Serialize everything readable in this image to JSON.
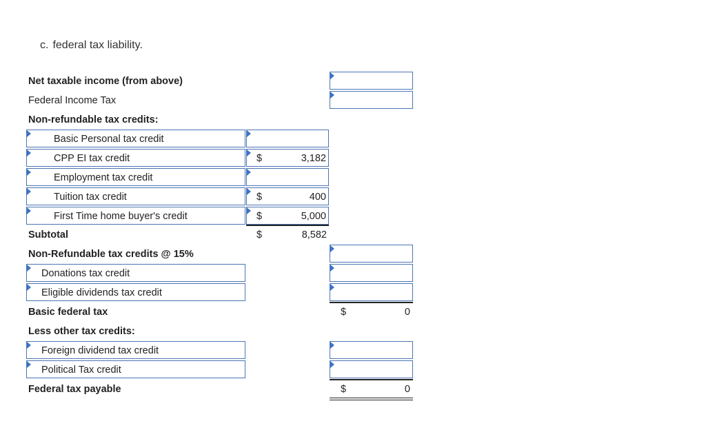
{
  "heading": {
    "letter": "c.",
    "text": "federal tax liability."
  },
  "rows": {
    "net_taxable_income": {
      "label": "Net taxable income (from above)",
      "value": ""
    },
    "federal_income_tax": {
      "label": "Federal Income Tax",
      "value": ""
    },
    "nonrefundable_header": {
      "label": "Non-refundable tax credits:"
    },
    "basic_personal": {
      "label": "Basic Personal tax credit",
      "currency": "",
      "value": ""
    },
    "cpp_ei": {
      "label": "CPP EI tax credit",
      "currency": "$",
      "value": "3,182"
    },
    "employment": {
      "label": "Employment tax credit",
      "currency": "",
      "value": ""
    },
    "tuition": {
      "label": "Tuition tax credit",
      "currency": "$",
      "value": "400"
    },
    "first_time_home": {
      "label": "First Time home buyer's credit",
      "currency": "$",
      "value": "5,000"
    },
    "subtotal": {
      "label": "Subtotal",
      "currency": "$",
      "value": "8,582"
    },
    "nonrefundable_15": {
      "label": "Non-Refundable tax credits @ 15%",
      "value": ""
    },
    "donations": {
      "label": "Donations tax credit",
      "value": ""
    },
    "eligible_dividends": {
      "label": "Eligible dividends tax credit",
      "value": ""
    },
    "basic_federal_tax": {
      "label": "Basic federal tax",
      "currency": "$",
      "value": "0"
    },
    "less_other_header": {
      "label": "Less other tax credits:"
    },
    "foreign_dividend": {
      "label": "Foreign dividend tax credit",
      "value": ""
    },
    "political": {
      "label": "Political Tax credit",
      "value": ""
    },
    "federal_tax_payable": {
      "label": "Federal tax payable",
      "currency": "$",
      "value": "0"
    }
  },
  "colors": {
    "field_border": "#4a74b4",
    "field_marker": "#3d73c4",
    "text": "#222222"
  }
}
